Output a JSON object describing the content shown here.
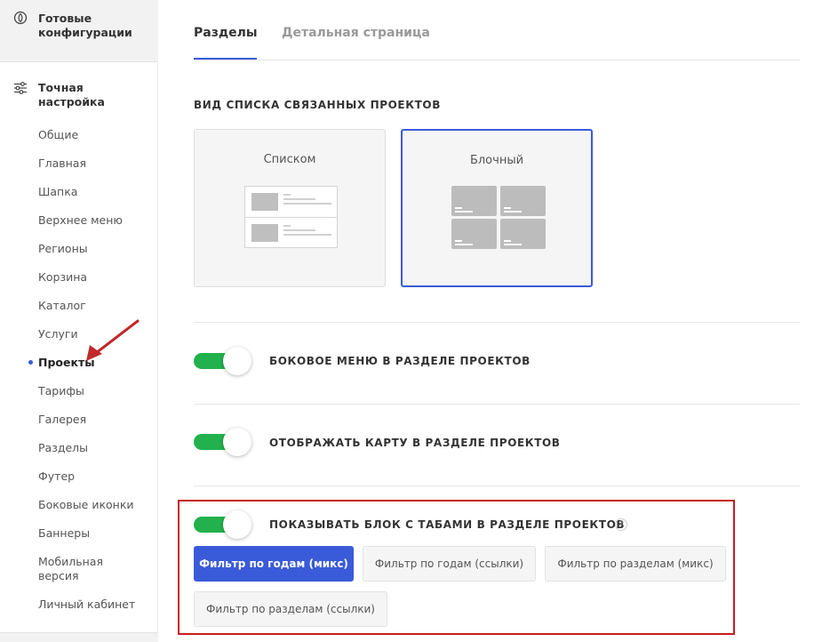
{
  "sidebar": {
    "ready_config": "Готовые конфигурации",
    "fine_tune": "Точная настройка",
    "items": [
      {
        "label": "Общие"
      },
      {
        "label": "Главная"
      },
      {
        "label": "Шапка"
      },
      {
        "label": "Верхнее меню"
      },
      {
        "label": "Регионы"
      },
      {
        "label": "Корзина"
      },
      {
        "label": "Каталог"
      },
      {
        "label": "Услуги"
      },
      {
        "label": "Проекты"
      },
      {
        "label": "Тарифы"
      },
      {
        "label": "Галерея"
      },
      {
        "label": "Разделы"
      },
      {
        "label": "Футер"
      },
      {
        "label": "Боковые иконки"
      },
      {
        "label": "Баннеры"
      },
      {
        "label": "Мобильная версия"
      },
      {
        "label": "Личный кабинет"
      }
    ],
    "active_item": "Проекты"
  },
  "tabs": [
    {
      "label": "Разделы",
      "active": true
    },
    {
      "label": "Детальная страница",
      "active": false
    }
  ],
  "view_section": {
    "title": "ВИД СПИСКА СВЯЗАННЫХ ПРОЕКТОВ",
    "options": [
      {
        "label": "Списком",
        "selected": false
      },
      {
        "label": "Блочный",
        "selected": true
      }
    ]
  },
  "toggles": [
    {
      "label": "БОКОВОЕ МЕНЮ В РАЗДЕЛЕ ПРОЕКТОВ",
      "on": true
    },
    {
      "label": "ОТОБРАЖАТЬ КАРТУ В РАЗДЕЛЕ ПРОЕКТОВ",
      "on": true
    },
    {
      "label": "ПОКАЗЫВАТЬ БЛОК С ТАБАМИ В РАЗДЕЛЕ ПРОЕКТОВ",
      "on": true
    }
  ],
  "help_glyph": "?",
  "filter_buttons": [
    {
      "label": "Фильтр по годам (микс)",
      "selected": true
    },
    {
      "label": "Фильтр по годам (ссылки)",
      "selected": false
    },
    {
      "label": "Фильтр по разделам (микс)",
      "selected": false
    },
    {
      "label": "Фильтр по разделам (ссылки)",
      "selected": false
    }
  ],
  "colors": {
    "accent": "#3a5bd9",
    "toggle_on": "#22b14c",
    "highlight_frame": "#c81e1e"
  }
}
